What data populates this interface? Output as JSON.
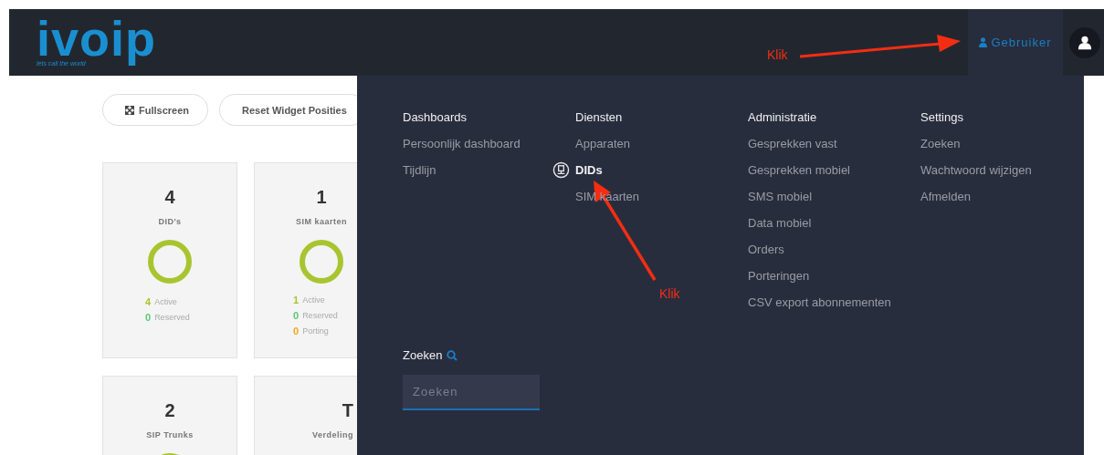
{
  "header": {
    "logo": {
      "name": "ivoip",
      "tagline": "lets call the world"
    },
    "user_menu": {
      "label": "Gebruiker"
    }
  },
  "toolbar": {
    "buttons": [
      {
        "label": "Fullscreen",
        "kind": "fullscreen"
      },
      {
        "label": "Reset Widget Posities",
        "kind": "plain"
      }
    ]
  },
  "widgets": [
    {
      "count": "4",
      "title": "DID's",
      "donut": true,
      "legend": [
        {
          "value": "4",
          "label": "Active",
          "color": "#a8c530"
        },
        {
          "value": "0",
          "label": "Reserved",
          "color": "#5bc873"
        }
      ]
    },
    {
      "count": "1",
      "title": "SIM kaarten",
      "donut": true,
      "legend": [
        {
          "value": "1",
          "label": "Active",
          "color": "#a8c530"
        },
        {
          "value": "0",
          "label": "Reserved",
          "color": "#5bc873"
        },
        {
          "value": "0",
          "label": "Porting",
          "color": "#f5a623"
        }
      ]
    },
    {
      "count": "2",
      "title": "SIP Trunks",
      "donut": true
    },
    {
      "count": "T",
      "title": "Verdeling",
      "donut": false
    }
  ],
  "dropdown": {
    "columns": [
      {
        "heading": "Dashboards",
        "items": [
          {
            "label": "Persoonlijk dashboard",
            "selected": false
          },
          {
            "label": "Tijdlijn",
            "selected": false
          }
        ]
      },
      {
        "heading": "Diensten",
        "items": [
          {
            "label": "Apparaten",
            "selected": false
          },
          {
            "label": "DIDs",
            "selected": true
          },
          {
            "label": "SIM kaarten",
            "selected": false
          }
        ]
      },
      {
        "heading": "Administratie",
        "items": [
          {
            "label": "Gesprekken vast",
            "selected": false
          },
          {
            "label": "Gesprekken mobiel",
            "selected": false
          },
          {
            "label": "SMS mobiel",
            "selected": false
          },
          {
            "label": "Data mobiel",
            "selected": false
          },
          {
            "label": "Orders",
            "selected": false
          },
          {
            "label": "Porteringen",
            "selected": false
          },
          {
            "label": "CSV export abonnementen",
            "selected": false
          }
        ]
      },
      {
        "heading": "Settings",
        "items": [
          {
            "label": "Zoeken",
            "selected": false
          },
          {
            "label": "Wachtwoord wijzigen",
            "selected": false
          },
          {
            "label": "Afmelden",
            "selected": false
          }
        ]
      }
    ],
    "search": {
      "label": "Zoeken",
      "placeholder": "Zoeken"
    }
  },
  "annotations": [
    {
      "text": "Klik"
    },
    {
      "text": "Klik"
    }
  ]
}
